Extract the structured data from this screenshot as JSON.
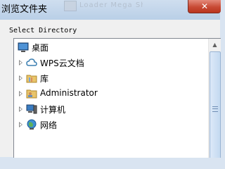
{
  "window": {
    "title": "浏览文件夹",
    "background_title": "Loader Mega Shrink",
    "close_glyph": "✕"
  },
  "dialog": {
    "prompt": "Select Directory"
  },
  "tree": {
    "items": [
      {
        "label": "桌面",
        "icon": "desktop-icon"
      },
      {
        "label": "WPS云文档",
        "icon": "cloud-icon"
      },
      {
        "label": "库",
        "icon": "library-folder-icon"
      },
      {
        "label": "Administrator",
        "icon": "user-folder-icon"
      },
      {
        "label": "计算机",
        "icon": "computer-icon"
      },
      {
        "label": "网络",
        "icon": "network-icon"
      }
    ]
  },
  "scrollbar": {
    "up_glyph": "▲"
  },
  "colors": {
    "accent": "#3c7fb1",
    "close": "#c84a35",
    "folder": "#e9c46a"
  }
}
